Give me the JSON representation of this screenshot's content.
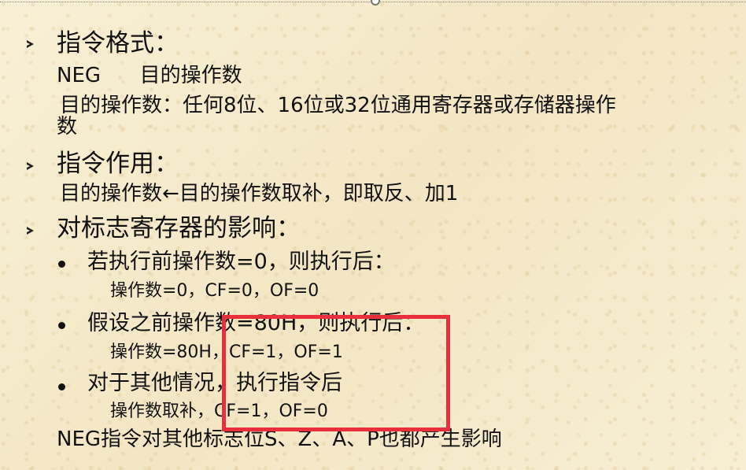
{
  "slide": {
    "sections": [
      {
        "heading": "指令格式：",
        "lines": [
          "NEG      目的操作数",
          "目的操作数：任何8位、16位或32位通用寄存器或存储器操作",
          "数"
        ]
      },
      {
        "heading": "指令作用：",
        "lines": [
          "目的操作数←目的操作数取补，即取反、加1"
        ]
      },
      {
        "heading": "对标志寄存器的影响：",
        "bullets": [
          {
            "text": "若执行前操作数=0，则执行后：",
            "detail": "操作数=0，CF=0，OF=0"
          },
          {
            "text": "假设之前操作数=80H，则执行后：",
            "detail": "操作数=80H，CF=1，OF=1"
          },
          {
            "text": "对于其他情况，执行指令后",
            "detail": "操作数取补，CF=1，OF=0"
          }
        ],
        "footer": "NEG指令对其他标志位S、Z、A、P也都产生影响"
      }
    ],
    "highlight_color": "#e8303d"
  }
}
